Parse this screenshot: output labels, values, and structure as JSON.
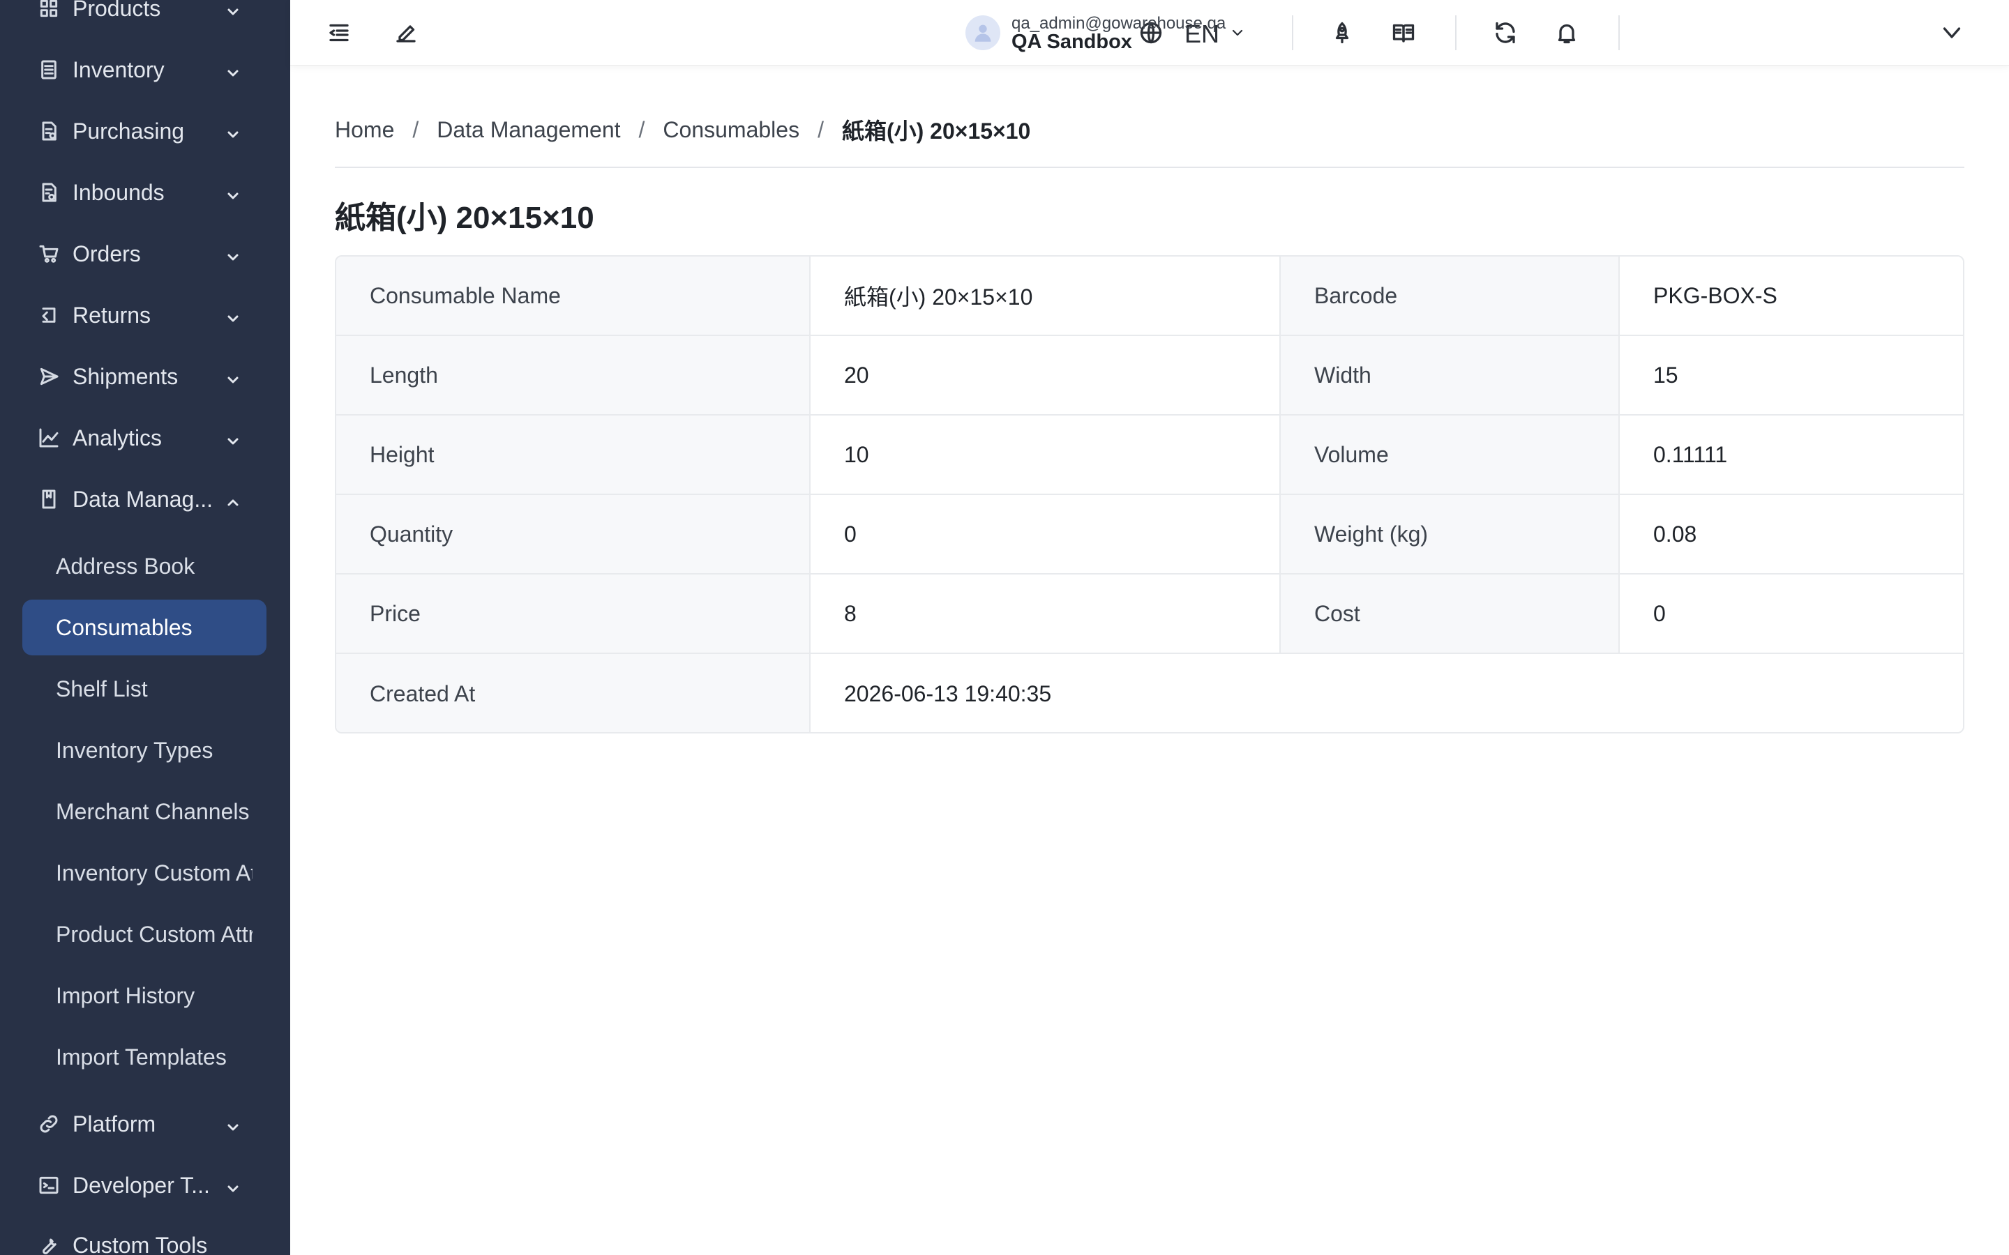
{
  "sidebar": {
    "items": [
      {
        "label": "Products",
        "icon": "grid-icon"
      },
      {
        "label": "Inventory",
        "icon": "inventory-icon"
      },
      {
        "label": "Purchasing",
        "icon": "purchase-doc-icon"
      },
      {
        "label": "Inbounds",
        "icon": "inbound-doc-icon"
      },
      {
        "label": "Orders",
        "icon": "cart-icon"
      },
      {
        "label": "Returns",
        "icon": "return-icon"
      },
      {
        "label": "Shipments",
        "icon": "send-icon"
      },
      {
        "label": "Analytics",
        "icon": "chart-line-icon"
      },
      {
        "label": "Data Manag...",
        "icon": "book-icon"
      },
      {
        "label": "Platform",
        "icon": "link-icon"
      },
      {
        "label": "Developer T...",
        "icon": "terminal-icon"
      },
      {
        "label": "Custom Tools",
        "icon": "wrench-icon"
      }
    ],
    "subitems": [
      {
        "label": "Address Book"
      },
      {
        "label": "Consumables"
      },
      {
        "label": "Shelf List"
      },
      {
        "label": "Inventory Types"
      },
      {
        "label": "Merchant Channels"
      },
      {
        "label": "Inventory Custom Attributes"
      },
      {
        "label": "Product Custom Attributes"
      },
      {
        "label": "Import History"
      },
      {
        "label": "Import Templates"
      }
    ]
  },
  "header": {
    "language": "EN",
    "user_email": "qa_admin@gowarehouse.qa",
    "user_org": "QA Sandbox"
  },
  "breadcrumb": [
    "Home",
    "Data Management",
    "Consumables",
    "紙箱(小) 20×15×10"
  ],
  "page": {
    "title": "紙箱(小) 20×15×10"
  },
  "details": {
    "rows": [
      [
        {
          "label": "Consumable Name",
          "value": "紙箱(小) 20×15×10"
        },
        {
          "label": "Barcode",
          "value": "PKG-BOX-S"
        }
      ],
      [
        {
          "label": "Length",
          "value": "20"
        },
        {
          "label": "Width",
          "value": "15"
        }
      ],
      [
        {
          "label": "Height",
          "value": "10"
        },
        {
          "label": "Volume",
          "value": "0.11111"
        }
      ],
      [
        {
          "label": "Quantity",
          "value": "0"
        },
        {
          "label": "Weight (kg)",
          "value": "0.08"
        }
      ],
      [
        {
          "label": "Price",
          "value": "8"
        },
        {
          "label": "Cost",
          "value": "0"
        }
      ],
      [
        {
          "label": "Created At",
          "value": "2026-06-13 19:40:35"
        }
      ]
    ]
  },
  "colors": {
    "sidebar_bg": "#283146",
    "active_item_bg": "#2f4d86",
    "label_cell_bg": "#f7f8fa"
  }
}
